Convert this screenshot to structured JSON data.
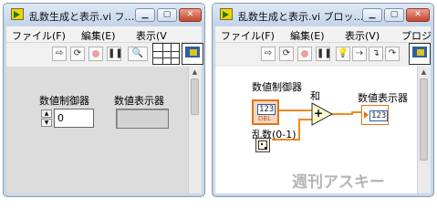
{
  "front_panel": {
    "title": "乱数生成と表示.vi フ…",
    "menu": [
      "ファイル(F)",
      "編集(E)",
      "表示(V"
    ],
    "control": {
      "label": "数値制御器",
      "value": "0"
    },
    "indicator": {
      "label": "数値表示器",
      "value": ""
    }
  },
  "block_diagram": {
    "title": "乱数生成と表示.vi ブロッ…",
    "menu": [
      "ファイル(F)",
      "編集(E)",
      "表示(V)",
      "プロジ"
    ],
    "control_terminal": {
      "label": "数値制御器",
      "text": "123",
      "type": "DBL"
    },
    "add_node": {
      "label": "和",
      "symbol": "+"
    },
    "indicator_terminal": {
      "label": "数値表示器",
      "text": "123"
    },
    "random_node": {
      "label": "乱数(0-1)"
    },
    "wire_color": "#f08a1e"
  },
  "window_buttons": {
    "minimize": "▁",
    "maximize": "▢",
    "close": "✕"
  },
  "watermark": "週刊アスキー"
}
